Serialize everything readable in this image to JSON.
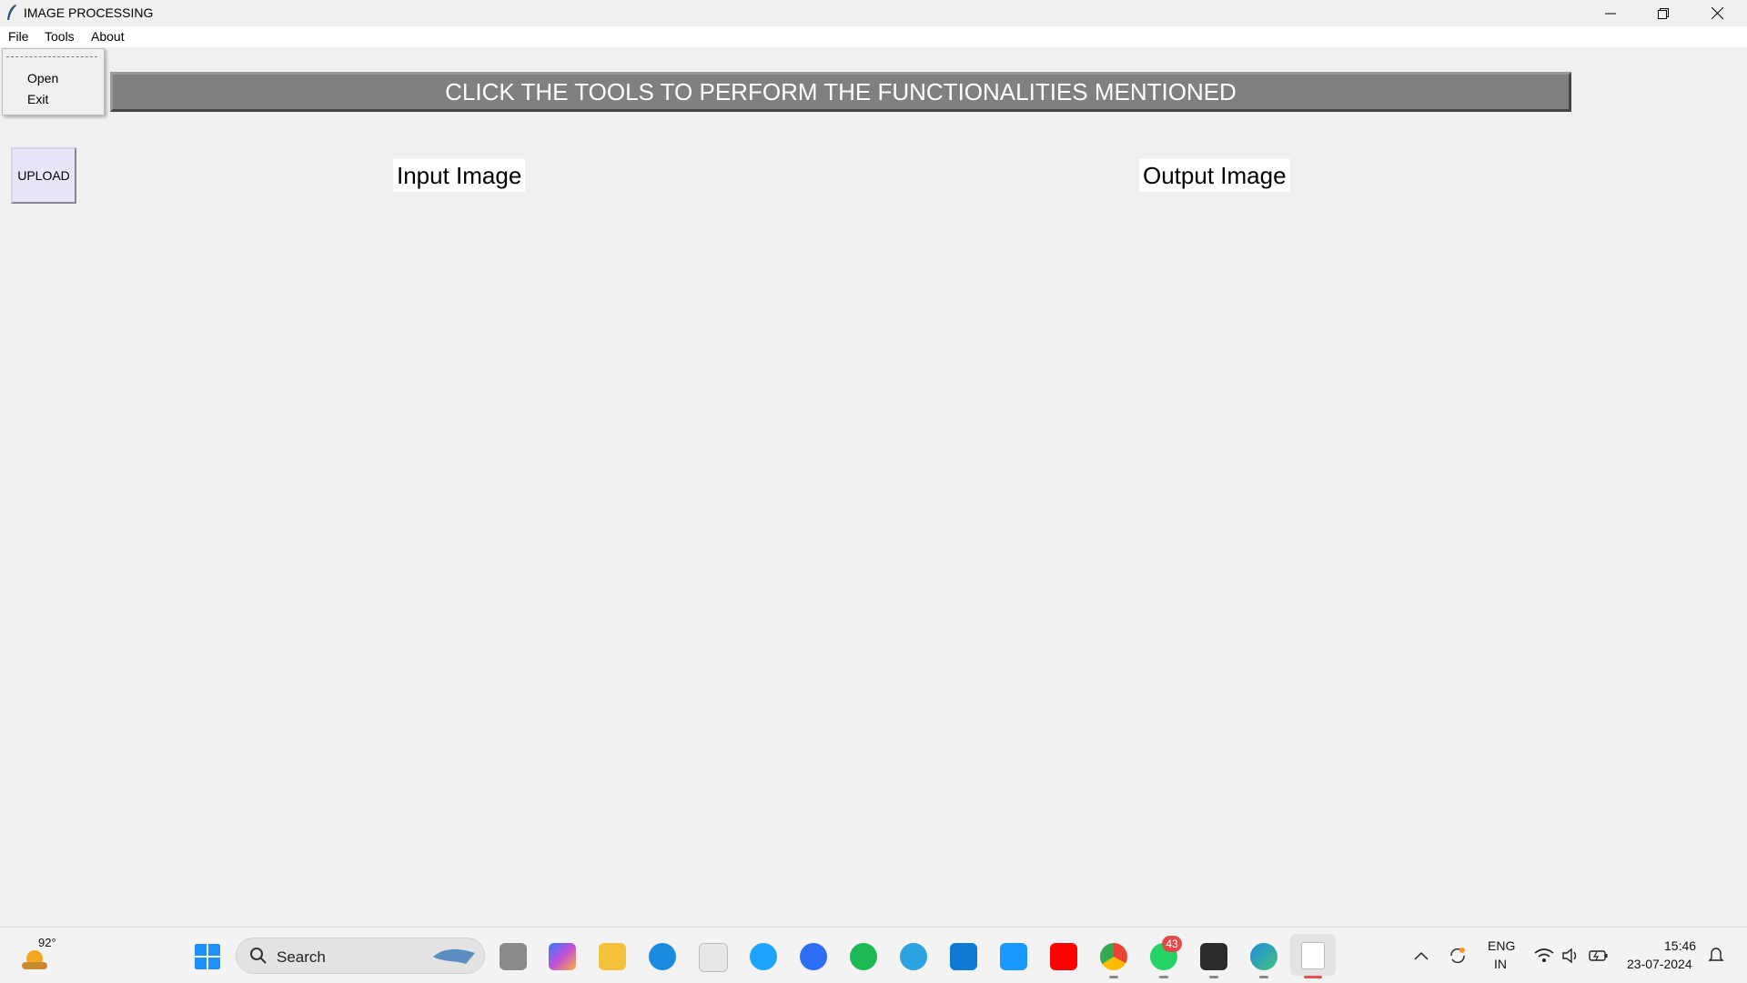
{
  "window": {
    "title": "IMAGE PROCESSING",
    "icon": "feather-icon",
    "controls": [
      "minimize-icon",
      "restore-icon",
      "close-icon"
    ]
  },
  "menubar": {
    "items": [
      "File",
      "Tools",
      "About"
    ]
  },
  "file_menu": {
    "tearoff": "- - - - - - - -",
    "items": [
      "Open",
      "Exit"
    ]
  },
  "main": {
    "banner": "CLICK THE TOOLS TO PERFORM THE FUNCTIONALITIES MENTIONED",
    "upload_label": "UPLOAD",
    "input_label": "Input Image",
    "output_label": "Output Image"
  },
  "taskbar": {
    "weather_temp": "92°",
    "search_placeholder": "Search",
    "whatsapp_badge": "43",
    "language": "ENG",
    "region": "IN",
    "time": "15:46",
    "date": "23-07-2024",
    "apps": [
      "windows-start-icon",
      "task-view-icon",
      "copilot-icon",
      "file-explorer-icon",
      "edge-icon",
      "store-icon",
      "help-icon",
      "zoom-icon",
      "spotify-icon",
      "telegram-icon",
      "vscode-icon",
      "prime-video-icon",
      "youtube-icon",
      "chrome-icon",
      "whatsapp-icon",
      "terminal-icon",
      "edge-dev-icon",
      "notepad-icon"
    ]
  },
  "colors": {
    "background": "#f0f0f0",
    "banner_bg": "#808080",
    "upload_bg": "#e6e6f8"
  }
}
